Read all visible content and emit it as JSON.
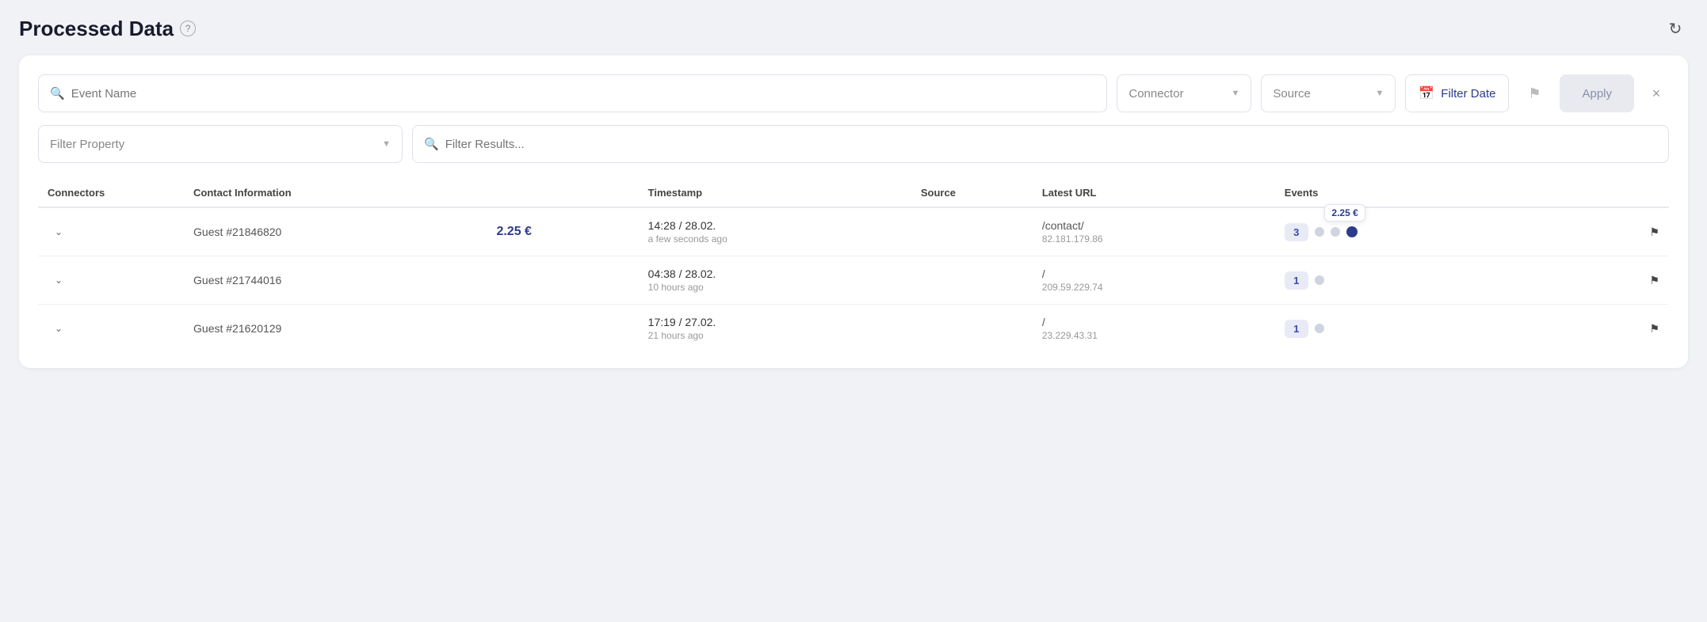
{
  "page": {
    "title": "Processed Data",
    "help_icon": "?",
    "refresh_icon": "↻"
  },
  "filters": {
    "event_name_placeholder": "Event Name",
    "connector_label": "Connector",
    "source_label": "Source",
    "filter_date_label": "Filter Date",
    "filter_property_label": "Filter Property",
    "filter_results_placeholder": "Filter Results...",
    "apply_label": "Apply",
    "close_label": "×"
  },
  "table": {
    "headers": {
      "connectors": "Connectors",
      "contact_info": "Contact Information",
      "timestamp": "Timestamp",
      "source": "Source",
      "latest_url": "Latest URL",
      "events": "Events"
    },
    "rows": [
      {
        "id": "row-1",
        "contact": "Guest #21846820",
        "price": "2.25 €",
        "timestamp_main": "14:28 / 28.02.",
        "timestamp_ago": "a few seconds ago",
        "source": "",
        "url_main": "/contact/",
        "url_ip": "82.181.179.86",
        "event_count": "3",
        "has_price_tooltip": true,
        "tooltip_price": "2.25 €",
        "dots": [
          "inactive",
          "inactive",
          "active"
        ]
      },
      {
        "id": "row-2",
        "contact": "Guest #21744016",
        "price": "",
        "timestamp_main": "04:38 / 28.02.",
        "timestamp_ago": "10 hours ago",
        "source": "",
        "url_main": "/",
        "url_ip": "209.59.229.74",
        "event_count": "1",
        "has_price_tooltip": false,
        "tooltip_price": "",
        "dots": [
          "inactive"
        ]
      },
      {
        "id": "row-3",
        "contact": "Guest #21620129",
        "price": "",
        "timestamp_main": "17:19 / 27.02.",
        "timestamp_ago": "21 hours ago",
        "source": "",
        "url_main": "/",
        "url_ip": "23.229.43.31",
        "event_count": "1",
        "has_price_tooltip": false,
        "tooltip_price": "",
        "dots": [
          "inactive"
        ]
      }
    ]
  }
}
